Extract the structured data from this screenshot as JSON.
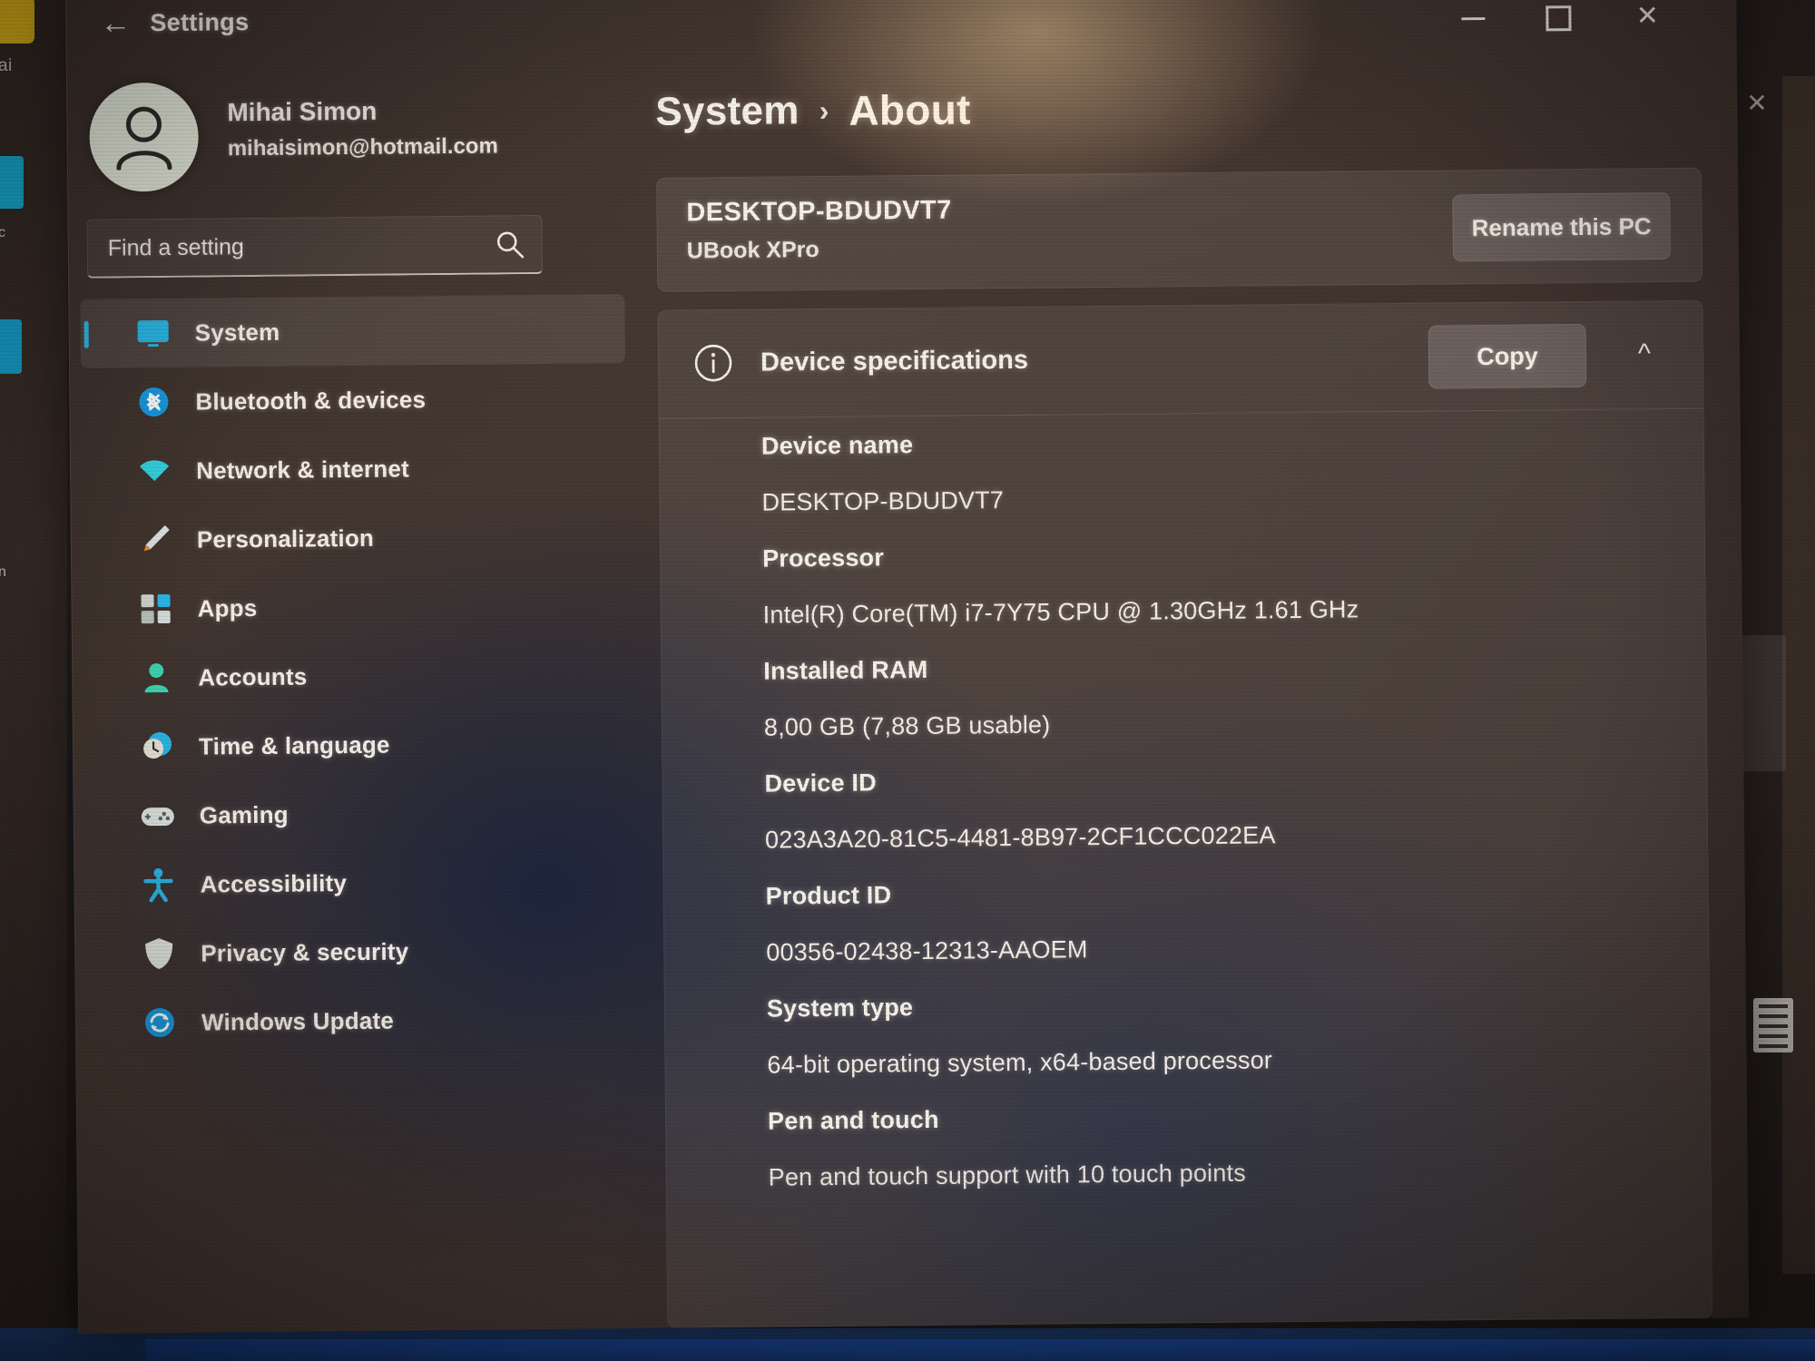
{
  "window": {
    "app_title": "Settings",
    "back_icon": "back-arrow-icon",
    "minimize_label": "Minimize",
    "maximize_label": "Maximize",
    "close_label": "Close"
  },
  "account": {
    "name": "Mihai Simon",
    "email": "mihaisimon@hotmail.com",
    "avatar_icon": "person-avatar-icon"
  },
  "search": {
    "value": "Find a setting",
    "placeholder": "Find a setting",
    "icon": "search-icon"
  },
  "sidebar": {
    "items": [
      {
        "label": "System",
        "icon": "monitor-icon",
        "selected": true
      },
      {
        "label": "Bluetooth & devices",
        "icon": "bluetooth-icon",
        "selected": false
      },
      {
        "label": "Network & internet",
        "icon": "wifi-icon",
        "selected": false
      },
      {
        "label": "Personalization",
        "icon": "paintbrush-icon",
        "selected": false
      },
      {
        "label": "Apps",
        "icon": "apps-grid-icon",
        "selected": false
      },
      {
        "label": "Accounts",
        "icon": "person-icon",
        "selected": false
      },
      {
        "label": "Time & language",
        "icon": "clock-globe-icon",
        "selected": false
      },
      {
        "label": "Gaming",
        "icon": "gamepad-icon",
        "selected": false
      },
      {
        "label": "Accessibility",
        "icon": "accessibility-icon",
        "selected": false
      },
      {
        "label": "Privacy & security",
        "icon": "shield-icon",
        "selected": false
      },
      {
        "label": "Windows Update",
        "icon": "update-sync-icon",
        "selected": false
      }
    ]
  },
  "breadcrumb": {
    "parent": "System",
    "separator": "›",
    "current": "About"
  },
  "pc_card": {
    "device_name": "DESKTOP-BDUDVT7",
    "model": "UBook XPro",
    "rename_button": "Rename this PC"
  },
  "device_specifications": {
    "title": "Device specifications",
    "info_icon": "info-circle-icon",
    "copy_button": "Copy",
    "collapse_icon": "chevron-up-icon",
    "rows": [
      {
        "label": "Device name",
        "value": "DESKTOP-BDUDVT7"
      },
      {
        "label": "Processor",
        "value": "Intel(R) Core(TM) i7-7Y75 CPU @ 1.30GHz   1.61 GHz"
      },
      {
        "label": "Installed RAM",
        "value": "8,00 GB (7,88 GB usable)"
      },
      {
        "label": "Device ID",
        "value": "023A3A20-81C5-4481-8B97-2CF1CCC022EA"
      },
      {
        "label": "Product ID",
        "value": "00356-02438-12313-AAOEM"
      },
      {
        "label": "System type",
        "value": "64-bit operating system, x64-based processor"
      },
      {
        "label": "Pen and touch",
        "value": "Pen and touch support with 10 touch points"
      }
    ]
  },
  "background": {
    "left_labels": [
      "ai",
      "c",
      "n"
    ],
    "close_icon": "close-icon"
  },
  "colors": {
    "accent": "#33b8e8",
    "bluetooth": "#1a9ae0",
    "wifi": "#35d3e0",
    "accounts": "#3fd6b0",
    "window_bg": "#41332e",
    "card_bg": "rgba(255,255,255,0.08)",
    "text": "#f4efe8"
  }
}
